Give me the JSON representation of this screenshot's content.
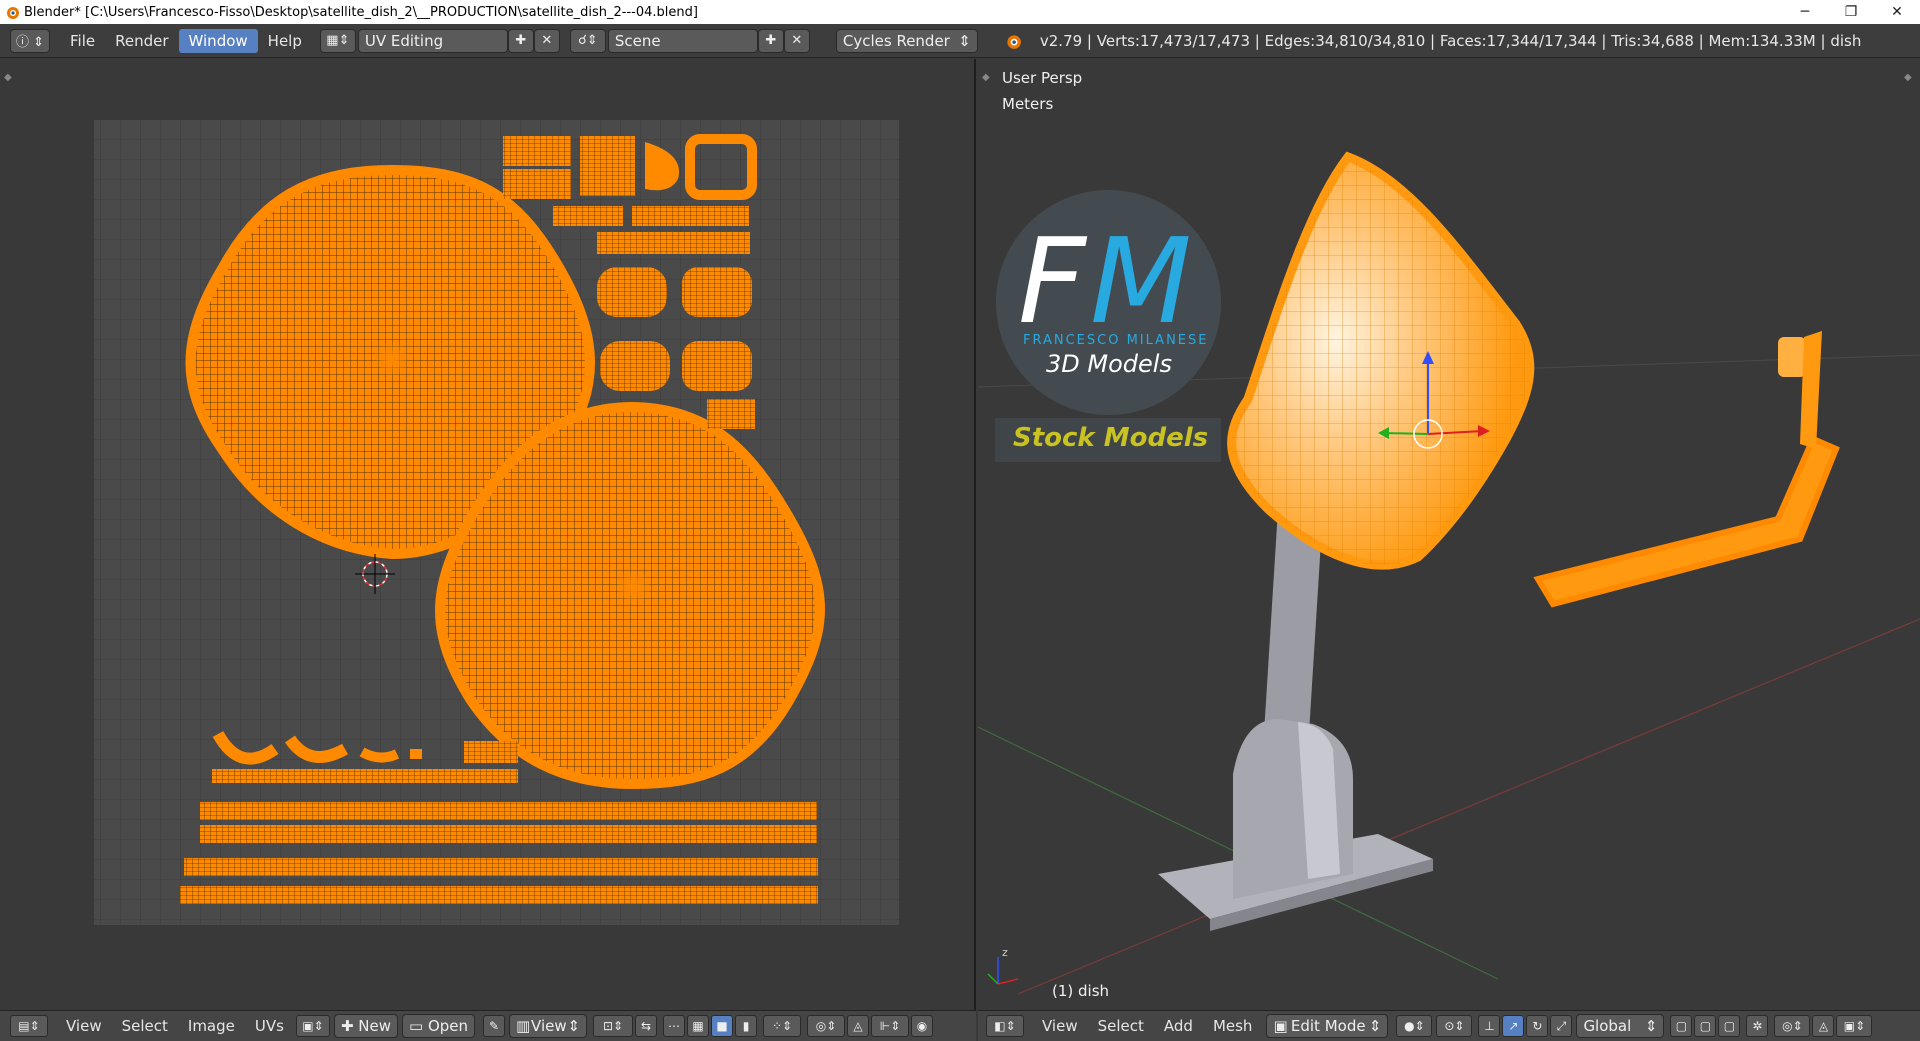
{
  "titlebar": {
    "title": "Blender* [C:\\Users\\Francesco-Fisso\\Desktop\\satellite_dish_2\\__PRODUCTION\\satellite_dish_2---04.blend]",
    "minimize": "─",
    "restore": "❐",
    "close": "✕"
  },
  "infobar": {
    "menus": [
      "File",
      "Render",
      "Window",
      "Help"
    ],
    "active_menu": "Window",
    "screen_layout": "UV Editing",
    "scene": "Scene",
    "engine": "Cycles Render",
    "stats": "v2.79 | Verts:17,473/17,473 | Edges:34,810/34,810 | Faces:17,344/17,344 | Tris:34,688 | Mem:134.33M | dish"
  },
  "viewport": {
    "view_name": "User Persp",
    "units": "Meters",
    "object_label": "(1) dish"
  },
  "logo": {
    "letter_f": "F",
    "letter_m": "M",
    "subtitle": "FRANCESCO MILANESE",
    "models": "3D Models",
    "stock": "Stock Models"
  },
  "uv_footer": {
    "menus": [
      "View",
      "Select",
      "Image",
      "UVs"
    ],
    "new_label": "New",
    "open_label": "Open",
    "view_label": "View"
  },
  "vp_footer": {
    "menus": [
      "View",
      "Select",
      "Add",
      "Mesh"
    ],
    "mode": "Edit Mode",
    "orientation": "Global"
  },
  "colors": {
    "uv_orange": "#ff8a00",
    "accent_blue": "#5680c2",
    "logo_blue": "#28a9e0",
    "stock_yellow": "#c9c321"
  }
}
